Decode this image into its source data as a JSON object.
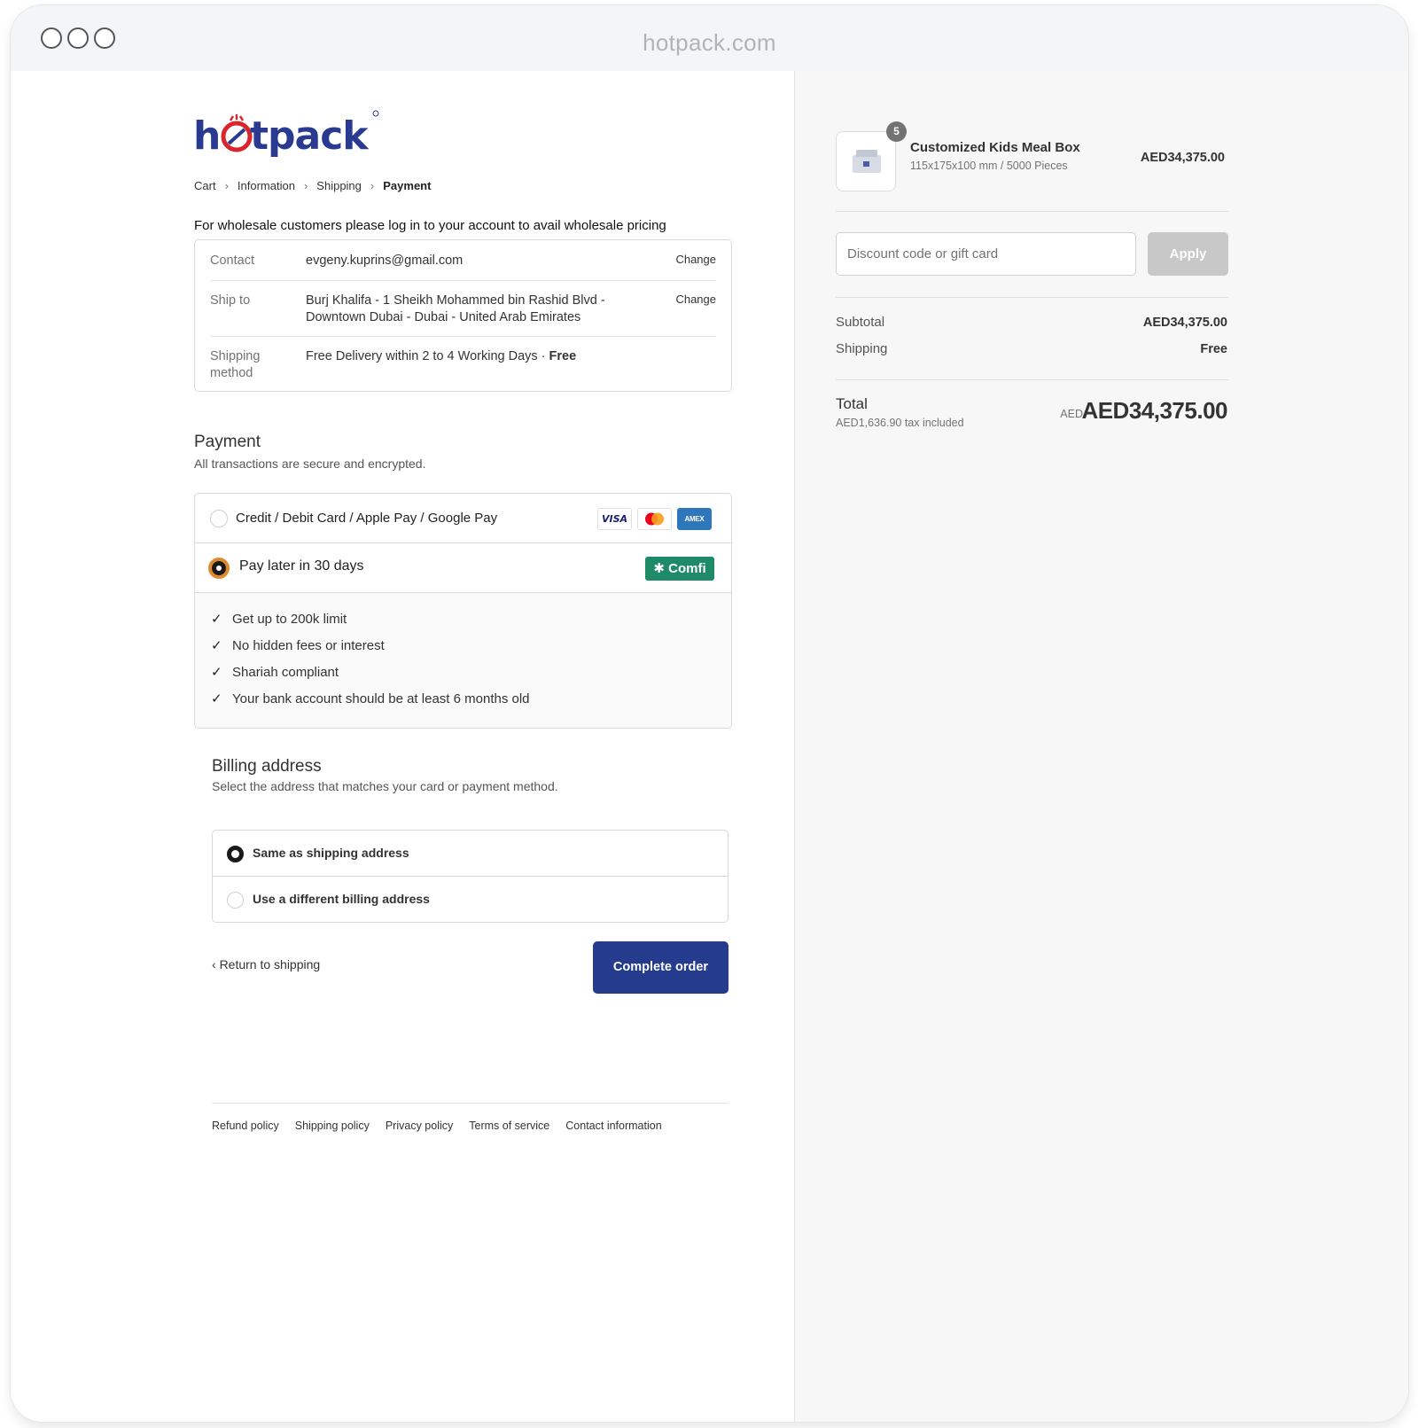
{
  "browser": {
    "url": "hotpack.com"
  },
  "brand": {
    "logo_text": "hotpack",
    "logo_color": "#2a3a91",
    "accent_red": "#d9262c"
  },
  "breadcrumb": [
    "Cart",
    "Information",
    "Shipping",
    "Payment"
  ],
  "wholesale_note": "For wholesale customers please log in to your account to avail wholesale pricing",
  "review": {
    "contact": {
      "label": "Contact",
      "value": "evgeny.kuprins@gmail.com",
      "action": "Change"
    },
    "ship_to": {
      "label": "Ship to",
      "value_line1": "Burj Khalifa - 1 Sheikh Mohammed bin Rashid Blvd -",
      "value_line2": "Downtown Dubai - Dubai - United Arab Emirates",
      "action": "Change"
    },
    "shipping_method": {
      "label_line1": "Shipping",
      "label_line2": "method",
      "value": "Free Delivery within 2 to 4 Working Days · ",
      "value_bold": "Free"
    }
  },
  "payment": {
    "title": "Payment",
    "subtitle": "All transactions are secure and encrypted.",
    "options": [
      {
        "label": "Credit / Debit Card / Apple Pay / Google Pay",
        "selected": false,
        "icons": [
          "visa-icon",
          "mastercard-icon",
          "amex-icon"
        ],
        "visa_text": "VISA",
        "amex_text": "AMEX"
      },
      {
        "label": "Pay later in 30 days",
        "selected": true,
        "provider_badge": "Comfi",
        "provider_glyph": "✱",
        "provider_color": "#1f8a67"
      }
    ],
    "benefits": [
      "Get up to 200k limit",
      "No hidden fees or interest",
      "Shariah compliant",
      "Your bank account should be at least 6 months old"
    ]
  },
  "billing": {
    "title": "Billing address",
    "subtitle": "Select the address that matches your card or payment method.",
    "options": [
      {
        "label": "Same as shipping address",
        "selected": true
      },
      {
        "label": "Use a different billing address",
        "selected": false
      }
    ]
  },
  "actions": {
    "return_label": "Return to shipping",
    "complete_label": "Complete order",
    "complete_color": "#253b8e"
  },
  "footer": [
    "Refund policy",
    "Shipping policy",
    "Privacy policy",
    "Terms of service",
    "Contact information"
  ],
  "summary": {
    "item": {
      "quantity": "5",
      "name": "Customized Kids Meal Box",
      "variant": "115x175x100 mm / 5000 Pieces",
      "price": "AED34,375.00"
    },
    "discount_placeholder": "Discount code or gift card",
    "apply_label": "Apply",
    "subtotal_label": "Subtotal",
    "subtotal_value": "AED34,375.00",
    "shipping_label": "Shipping",
    "shipping_value": "Free",
    "total_label": "Total",
    "tax_note": "AED1,636.90 tax included",
    "currency": "AED",
    "total_value": "AED34,375.00"
  }
}
